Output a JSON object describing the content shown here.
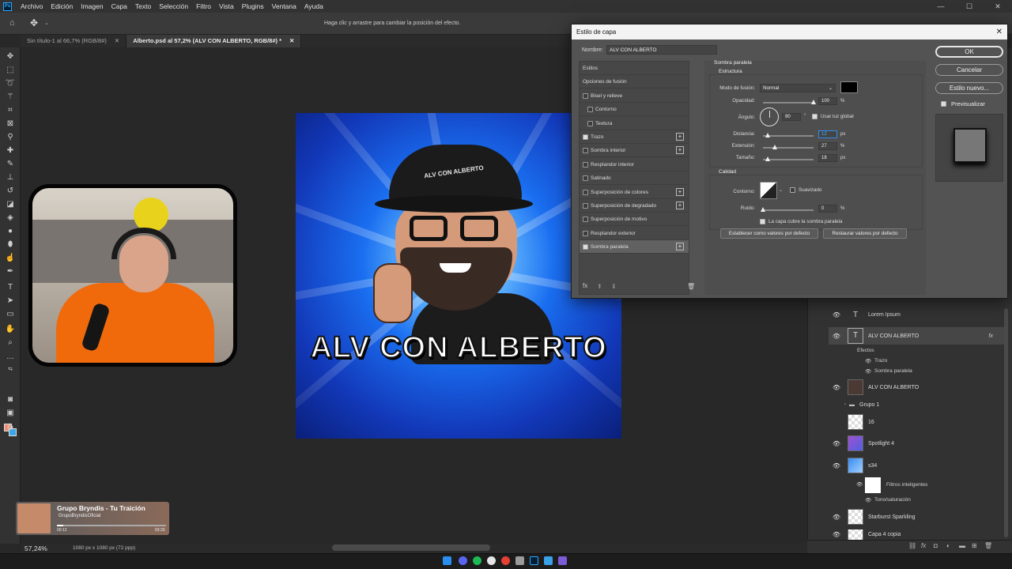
{
  "menubar": {
    "logo": "Ps",
    "items": [
      "Archivo",
      "Edición",
      "Imagen",
      "Capa",
      "Texto",
      "Selección",
      "Filtro",
      "Vista",
      "Plugins",
      "Ventana",
      "Ayuda"
    ]
  },
  "optbar": {
    "hint": "Haga clic y arrastre para cambiar la posición del efecto."
  },
  "tabs": [
    {
      "label": "Sin título-1 al 66,7% (RGB/8#)"
    },
    {
      "label": "Alberto.psd al 57,2% (ALV CON ALBERTO, RGB/8#) *"
    }
  ],
  "artwork": {
    "title": "ALV CON ALBERTO",
    "cap_text": "ALV CON ALBERTO"
  },
  "music": {
    "title": "Grupo Bryndis - Tu Traición",
    "channel": "GrupoBryndisOficial",
    "elapsed": "00:12",
    "duration": "03:33",
    "progress": 0.06
  },
  "status": {
    "zoom": "57,24%",
    "doc": "1080 px x 1080 px (72 ppp)"
  },
  "layers": [
    {
      "name": "Lorem Ipsum",
      "type": "text",
      "visible": true
    },
    {
      "name": "ALV CON ALBERTO",
      "type": "text",
      "visible": true,
      "selected": true,
      "fx": "fx"
    },
    {
      "name": "ALV CON ALBERTO",
      "type": "image",
      "visible": true
    },
    {
      "name": "Grupo 1",
      "type": "group",
      "visible": false
    },
    {
      "name": "16",
      "type": "image",
      "visible": false
    },
    {
      "name": "Spotlight 4",
      "type": "image",
      "visible": true
    },
    {
      "name": "s34",
      "type": "smart",
      "visible": true
    },
    {
      "name": "Starburst Sparkling",
      "type": "image",
      "visible": true
    },
    {
      "name": "Capa 4 copia",
      "type": "image",
      "visible": true
    }
  ],
  "layer_effects": {
    "label": "Efectos",
    "items": [
      "Trazo",
      "Sombra paralela"
    ]
  },
  "smart_filters": {
    "label": "Filtros inteligentes",
    "item": "Tono/saturación"
  },
  "dialog": {
    "title": "Estilo de capa",
    "close": "✕",
    "name_label": "Nombre:",
    "name_value": "ALV CON ALBERTO",
    "styles": [
      {
        "label": "Estilos",
        "cb": null,
        "plus": false,
        "indent": 0
      },
      {
        "label": "Opciones de fusión",
        "cb": null,
        "plus": false,
        "indent": 0
      },
      {
        "label": "Bisel y relieve",
        "cb": false,
        "plus": false,
        "indent": 0
      },
      {
        "label": "Contorno",
        "cb": false,
        "plus": false,
        "indent": 1
      },
      {
        "label": "Textura",
        "cb": false,
        "plus": false,
        "indent": 1
      },
      {
        "label": "Trazo",
        "cb": true,
        "plus": true,
        "indent": 0
      },
      {
        "label": "Sombra interior",
        "cb": false,
        "plus": true,
        "indent": 0
      },
      {
        "label": "Resplandor interior",
        "cb": false,
        "plus": false,
        "indent": 0
      },
      {
        "label": "Satinado",
        "cb": false,
        "plus": false,
        "indent": 0
      },
      {
        "label": "Superposición de colores",
        "cb": false,
        "plus": true,
        "indent": 0
      },
      {
        "label": "Superposición de degradado",
        "cb": false,
        "plus": true,
        "indent": 0
      },
      {
        "label": "Superposición de motivo",
        "cb": false,
        "plus": false,
        "indent": 0
      },
      {
        "label": "Resplandor exterior",
        "cb": false,
        "plus": false,
        "indent": 0
      },
      {
        "label": "Sombra paralela",
        "cb": true,
        "plus": true,
        "indent": 0,
        "selected": true
      }
    ],
    "fx_label": "fx",
    "section_title": "Sombra paralela",
    "structure_title": "Estructura",
    "blend_label": "Modo de fusión:",
    "blend_value": "Normal",
    "shadow_color": "#000000",
    "opacity_label": "Opacidad:",
    "opacity_value": "100",
    "angle_label": "Ángulo:",
    "angle_value": "90",
    "angle_unit": "°",
    "global_light_label": "Usar luz global",
    "distance_label": "Distancia:",
    "distance_value": "12",
    "spread_label": "Extensión:",
    "spread_value": "27",
    "size_label": "Tamaño:",
    "size_value": "18",
    "px": "px",
    "pct": "%",
    "quality_title": "Calidad",
    "contour_label": "Contorno:",
    "smooth_label": "Suavizado",
    "noise_label": "Ruido:",
    "noise_value": "0",
    "knockout_label": "La capa cubre la sombra paralela",
    "default_set": "Establecer como valores por defecto",
    "default_reset": "Restaurar valores por defecto",
    "ok": "OK",
    "cancel": "Cancelar",
    "new_style": "Estilo nuevo...",
    "preview_label": "Previsualizar"
  }
}
